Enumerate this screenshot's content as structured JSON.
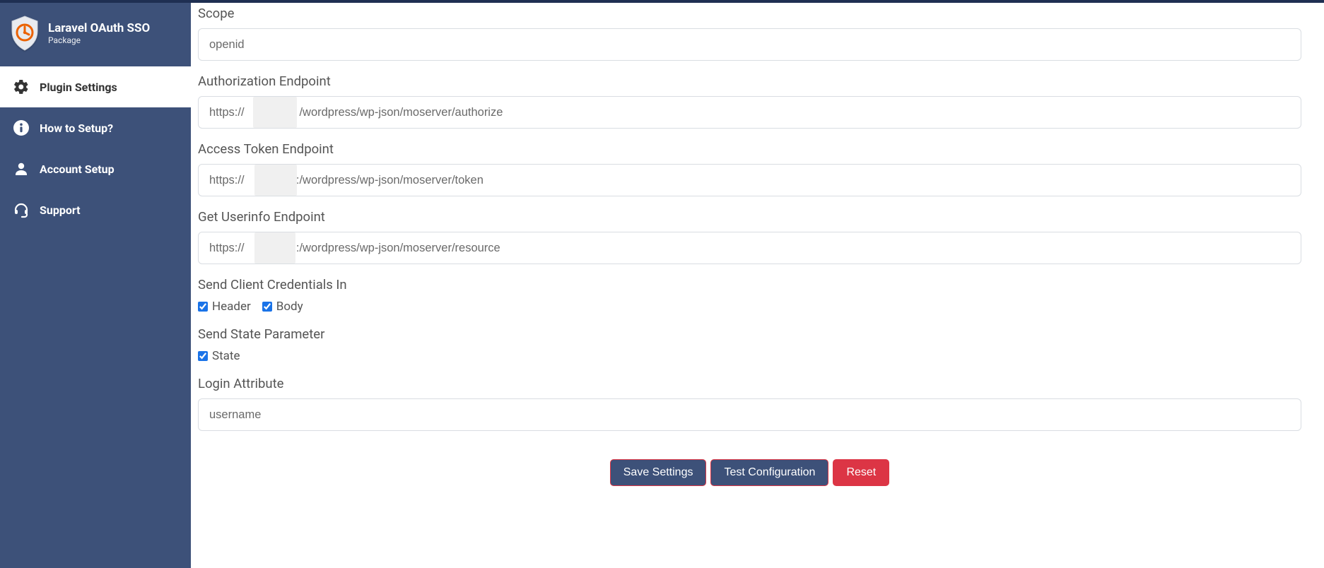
{
  "brand": {
    "title": "Laravel OAuth SSO",
    "subtitle": "Package",
    "accent": "#eb6100"
  },
  "sidebar": {
    "items": [
      {
        "label": "Plugin Settings",
        "icon": "gear-icon",
        "active": true
      },
      {
        "label": "How to Setup?",
        "icon": "info-icon",
        "active": false
      },
      {
        "label": "Account Setup",
        "icon": "user-icon",
        "active": false
      },
      {
        "label": "Support",
        "icon": "headset-icon",
        "active": false
      }
    ]
  },
  "form": {
    "scope": {
      "label": "Scope",
      "value": "openid"
    },
    "authorization_endpoint": {
      "label": "Authorization Endpoint",
      "value": "https://                 /wordpress/wp-json/moserver/authorize"
    },
    "access_token_endpoint": {
      "label": "Access Token Endpoint",
      "value": "https://                :/wordpress/wp-json/moserver/token"
    },
    "userinfo_endpoint": {
      "label": "Get Userinfo Endpoint",
      "value": "https://                :/wordpress/wp-json/moserver/resource"
    },
    "credentials": {
      "label": "Send Client Credentials In",
      "header": {
        "label": "Header",
        "checked": true
      },
      "body": {
        "label": "Body",
        "checked": true
      }
    },
    "state_param": {
      "label": "Send State Parameter",
      "state": {
        "label": "State",
        "checked": true
      }
    },
    "login_attribute": {
      "label": "Login Attribute",
      "value": "username"
    },
    "actions": {
      "save": "Save Settings",
      "test": "Test Configuration",
      "reset": "Reset"
    }
  }
}
